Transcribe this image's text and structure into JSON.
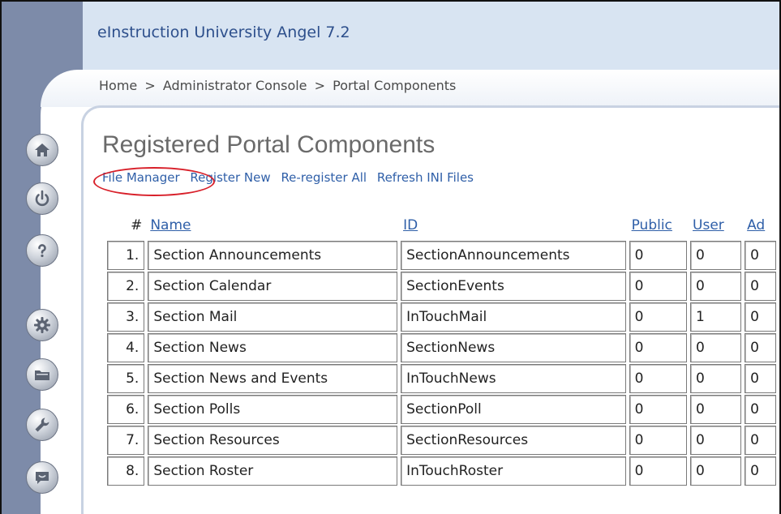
{
  "app": {
    "title": "eInstruction University Angel 7.2"
  },
  "breadcrumb": {
    "items": [
      "Home",
      "Administrator Console",
      "Portal Components"
    ],
    "separator": ">"
  },
  "page": {
    "title": "Registered Portal Components"
  },
  "actions": {
    "file_manager": "File Manager",
    "register_new": "Register New",
    "reregister_all": "Re-register All",
    "refresh_ini": "Refresh INI Files"
  },
  "table": {
    "headers": {
      "num": "#",
      "name": "Name",
      "id": "ID",
      "public": "Public",
      "user": "User",
      "admin": "Ad"
    },
    "rows": [
      {
        "num": "1.",
        "name": "Section Announcements",
        "id": "SectionAnnouncements",
        "public": "0",
        "user": "0",
        "admin": "0"
      },
      {
        "num": "2.",
        "name": "Section Calendar",
        "id": "SectionEvents",
        "public": "0",
        "user": "0",
        "admin": "0"
      },
      {
        "num": "3.",
        "name": "Section Mail",
        "id": "InTouchMail",
        "public": "0",
        "user": "1",
        "admin": "0"
      },
      {
        "num": "4.",
        "name": "Section News",
        "id": "SectionNews",
        "public": "0",
        "user": "0",
        "admin": "0"
      },
      {
        "num": "5.",
        "name": "Section News and Events",
        "id": "InTouchNews",
        "public": "0",
        "user": "0",
        "admin": "0"
      },
      {
        "num": "6.",
        "name": "Section Polls",
        "id": "SectionPoll",
        "public": "0",
        "user": "0",
        "admin": "0"
      },
      {
        "num": "7.",
        "name": "Section Resources",
        "id": "SectionResources",
        "public": "0",
        "user": "0",
        "admin": "0"
      },
      {
        "num": "8.",
        "name": "Section Roster",
        "id": "InTouchRoster",
        "public": "0",
        "user": "0",
        "admin": "0"
      }
    ]
  },
  "sidebar": {
    "icons": [
      "home-icon",
      "power-icon",
      "help-icon",
      "gear-icon",
      "folder-icon",
      "wrench-icon",
      "chat-icon"
    ]
  },
  "colors": {
    "accent": "#2f5fa8",
    "highlight": "#d8202a",
    "sidebar": "#7d8ba9",
    "header": "#d8e4f2"
  }
}
